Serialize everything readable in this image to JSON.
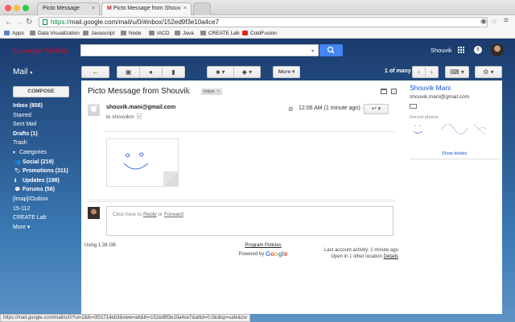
{
  "browser": {
    "tabs": [
      {
        "label": "Picto Message",
        "close": "×"
      },
      {
        "label": "Picto Message from Shouv",
        "close": "×"
      }
    ],
    "url_scheme": "https://",
    "url_rest": "mail.google.com/mail/u/0/#inbox/152ed9f3e10a4ce7",
    "bookmarks": [
      {
        "label": "Apps",
        "icon": "grid-icon",
        "color": "#5f7fd1"
      },
      {
        "label": "Data Visualization",
        "icon": "folder-icon",
        "color": "#8a8a8a"
      },
      {
        "label": "Javascript",
        "icon": "folder-icon",
        "color": "#8a8a8a"
      },
      {
        "label": "Node",
        "icon": "folder-icon",
        "color": "#8a8a8a"
      },
      {
        "label": "IACD",
        "icon": "folder-icon",
        "color": "#8a8a8a"
      },
      {
        "label": "Java",
        "icon": "folder-icon",
        "color": "#8a8a8a"
      },
      {
        "label": "CREATE Lab",
        "icon": "folder-icon",
        "color": "#8a8a8a"
      },
      {
        "label": "ColdFusion",
        "icon": "youtube-icon",
        "color": "#e62117"
      }
    ],
    "status_url": "https://mail.google.com/mail/u/0/?ui=2&ik=0f21714eb3&view=att&th=152ed9f3e10a4ce7&attid=0.0&disp=safe&zw"
  },
  "header": {
    "brand": "Carnegie Mellon",
    "user": "Shouvik",
    "notification_count": "8"
  },
  "toolbar": {
    "mail_label": "Mail",
    "more_label": "More",
    "paging": "1 of many"
  },
  "sidebar": {
    "compose": "COMPOSE",
    "items": [
      {
        "label": "Inbox (856)",
        "bold": true
      },
      {
        "label": "Starred",
        "bold": false
      },
      {
        "label": "Sent Mail",
        "bold": false
      },
      {
        "label": "Drafts (1)",
        "bold": true
      },
      {
        "label": "Trash",
        "bold": false
      },
      {
        "label": "Categories",
        "bold": false,
        "icon": "▾"
      },
      {
        "label": "Social (219)",
        "bold": true,
        "icon": "👥"
      },
      {
        "label": "Promotions (311)",
        "bold": true,
        "icon": "🏷"
      },
      {
        "label": "Updates (198)",
        "bold": true,
        "icon": "ℹ"
      },
      {
        "label": "Forums (56)",
        "bold": true,
        "icon": "💬"
      },
      {
        "label": "[Imap]/Outbox",
        "bold": false
      },
      {
        "label": "15-112",
        "bold": false
      },
      {
        "label": "CREATE Lab",
        "bold": false
      },
      {
        "label": "More ▾",
        "bold": false
      }
    ]
  },
  "message": {
    "subject": "Picto Message from Shouvik",
    "label_badge": "Inbox",
    "sender": "shouvik.mani@gmail.com",
    "to": "to shouvikm",
    "time": "12:06 AM (1 minute ago)",
    "reply_prompt_prefix": "Click here to ",
    "reply_link": "Reply",
    "reply_or": " or ",
    "forward_link": "Forward"
  },
  "footer": {
    "storage": "Using 1.38 GB",
    "program_policies": "Program Policies",
    "powered_by": "Powered by",
    "google": "Google",
    "last_activity": "Last account activity: 1 minute ago",
    "open_other": "Open in 1 other location",
    "details": "Details"
  },
  "contact": {
    "name": "Shouvik Mani",
    "email": "shouvik.mani@gmail.com",
    "recent_photos": "Recent photos",
    "show_details": "Show details"
  },
  "colors": {
    "accent_blue": "#4285f4",
    "brand_red": "#c41230"
  }
}
